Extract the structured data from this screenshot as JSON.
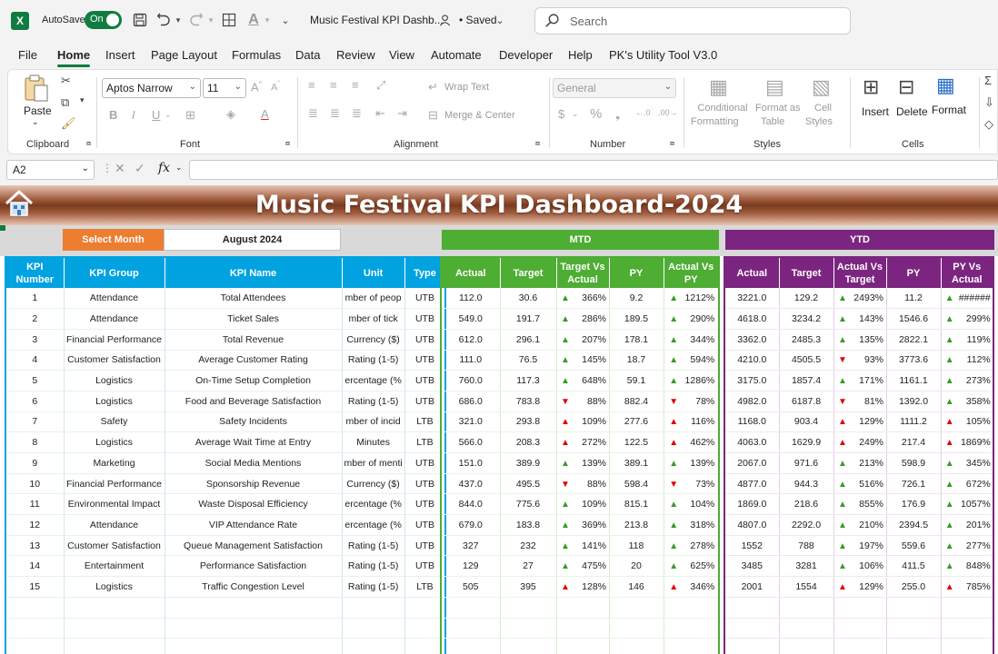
{
  "titlebar": {
    "autosave_label": "AutoSave",
    "toggle_label": "On",
    "doc_title": "Music Festival KPI Dashb...",
    "saved_label": "• Saved",
    "search_placeholder": "Search"
  },
  "menu": [
    "File",
    "Home",
    "Insert",
    "Page Layout",
    "Formulas",
    "Data",
    "Review",
    "View",
    "Automate",
    "Developer",
    "Help",
    "PK's Utility Tool V3.0"
  ],
  "ribbon": {
    "paste": "Paste",
    "clipboard": "Clipboard",
    "font_name": "Aptos Narrow",
    "font_size": "11",
    "font": "Font",
    "wrap_text": "Wrap Text",
    "merge_center": "Merge & Center",
    "alignment": "Alignment",
    "number_format": "General",
    "number": "Number",
    "conditional_formatting": [
      "Conditional",
      "Formatting"
    ],
    "format_as_table": [
      "Format as",
      "Table"
    ],
    "cell_styles": [
      "Cell",
      "Styles"
    ],
    "styles": "Styles",
    "insert": "Insert",
    "delete": "Delete",
    "format": "Format",
    "cells": "Cells"
  },
  "formula_bar": {
    "name_box": "A2",
    "fx": "fx",
    "content": ""
  },
  "sheet": {
    "title": "Music Festival KPI Dashboard-2024",
    "select_month_label": "Select Month",
    "select_month_value": "August 2024",
    "mtd_label": "MTD",
    "ytd_label": "YTD",
    "left_headers": [
      [
        "KPI",
        "Number"
      ],
      [
        "KPI Group"
      ],
      [
        "KPI Name"
      ],
      [
        "Unit"
      ],
      [
        "Type"
      ]
    ],
    "mtd_headers": [
      [
        "Actual"
      ],
      [
        "Target"
      ],
      [
        "Target Vs",
        "Actual"
      ],
      [
        "PY"
      ],
      [
        "Actual Vs",
        "PY"
      ]
    ],
    "ytd_headers": [
      [
        "Actual"
      ],
      [
        "Target"
      ],
      [
        "Actual Vs",
        "Target"
      ],
      [
        "PY"
      ],
      [
        "PY Vs",
        "Actual"
      ]
    ],
    "colors": {
      "mtd": "#4ead33",
      "ytd": "#7b2580",
      "kpi": "#00a3e0",
      "select": "#ed7d31",
      "up": "#3a9a2a",
      "down": "#e00000"
    },
    "rows": [
      {
        "num": "1",
        "group": "Attendance",
        "name": "Total Attendees",
        "unit": "mber of peop",
        "type": "UTB",
        "m_act": "112.0",
        "m_tgt": "30.6",
        "m_tva_dir": "up",
        "m_tva": "366%",
        "m_py": "9.2",
        "m_avp_dir": "up",
        "m_avp": "1212%",
        "y_act": "3221.0",
        "y_tgt": "129.2",
        "y_avt_dir": "up",
        "y_avt": "2493%",
        "y_py": "11.2",
        "y_pva_dir": "up",
        "y_pva": "######"
      },
      {
        "num": "2",
        "group": "Attendance",
        "name": "Ticket Sales",
        "unit": "mber of tick",
        "type": "UTB",
        "m_act": "549.0",
        "m_tgt": "191.7",
        "m_tva_dir": "up",
        "m_tva": "286%",
        "m_py": "189.5",
        "m_avp_dir": "up",
        "m_avp": "290%",
        "y_act": "4618.0",
        "y_tgt": "3234.2",
        "y_avt_dir": "up",
        "y_avt": "143%",
        "y_py": "1546.6",
        "y_pva_dir": "up",
        "y_pva": "299%"
      },
      {
        "num": "3",
        "group": "Financial Performance",
        "name": "Total Revenue",
        "unit": "Currency ($)",
        "type": "UTB",
        "m_act": "612.0",
        "m_tgt": "296.1",
        "m_tva_dir": "up",
        "m_tva": "207%",
        "m_py": "178.1",
        "m_avp_dir": "up",
        "m_avp": "344%",
        "y_act": "3362.0",
        "y_tgt": "2485.3",
        "y_avt_dir": "up",
        "y_avt": "135%",
        "y_py": "2822.1",
        "y_pva_dir": "up",
        "y_pva": "119%"
      },
      {
        "num": "4",
        "group": "Customer Satisfaction",
        "name": "Average Customer Rating",
        "unit": "Rating (1-5)",
        "type": "UTB",
        "m_act": "111.0",
        "m_tgt": "76.5",
        "m_tva_dir": "up",
        "m_tva": "145%",
        "m_py": "18.7",
        "m_avp_dir": "up",
        "m_avp": "594%",
        "y_act": "4210.0",
        "y_tgt": "4505.5",
        "y_avt_dir": "down",
        "y_avt": "93%",
        "y_py": "3773.6",
        "y_pva_dir": "up",
        "y_pva": "112%"
      },
      {
        "num": "5",
        "group": "Logistics",
        "name": "On-Time Setup Completion",
        "unit": "ercentage (%",
        "type": "UTB",
        "m_act": "760.0",
        "m_tgt": "117.3",
        "m_tva_dir": "up",
        "m_tva": "648%",
        "m_py": "59.1",
        "m_avp_dir": "up",
        "m_avp": "1286%",
        "y_act": "3175.0",
        "y_tgt": "1857.4",
        "y_avt_dir": "up",
        "y_avt": "171%",
        "y_py": "1161.1",
        "y_pva_dir": "up",
        "y_pva": "273%"
      },
      {
        "num": "6",
        "group": "Logistics",
        "name": "Food and Beverage Satisfaction",
        "unit": "Rating (1-5)",
        "type": "UTB",
        "m_act": "686.0",
        "m_tgt": "783.8",
        "m_tva_dir": "down",
        "m_tva": "88%",
        "m_py": "882.4",
        "m_avp_dir": "down",
        "m_avp": "78%",
        "y_act": "4982.0",
        "y_tgt": "6187.8",
        "y_avt_dir": "down",
        "y_avt": "81%",
        "y_py": "1392.0",
        "y_pva_dir": "up",
        "y_pva": "358%"
      },
      {
        "num": "7",
        "group": "Safety",
        "name": "Safety Incidents",
        "unit": "mber of incid",
        "type": "LTB",
        "m_act": "321.0",
        "m_tgt": "293.8",
        "m_tva_dir": "down",
        "m_tva": "109%",
        "m_py": "277.6",
        "m_avp_dir": "down",
        "m_avp": "116%",
        "y_act": "1168.0",
        "y_tgt": "903.4",
        "y_avt_dir": "down",
        "y_avt": "129%",
        "y_py": "1111.2",
        "y_pva_dir": "down",
        "y_pva": "105%"
      },
      {
        "num": "8",
        "group": "Logistics",
        "name": "Average Wait Time at Entry",
        "unit": "Minutes",
        "type": "LTB",
        "m_act": "566.0",
        "m_tgt": "208.3",
        "m_tva_dir": "down",
        "m_tva": "272%",
        "m_py": "122.5",
        "m_avp_dir": "down",
        "m_avp": "462%",
        "y_act": "4063.0",
        "y_tgt": "1629.9",
        "y_avt_dir": "down",
        "y_avt": "249%",
        "y_py": "217.4",
        "y_pva_dir": "down",
        "y_pva": "1869%"
      },
      {
        "num": "9",
        "group": "Marketing",
        "name": "Social Media Mentions",
        "unit": "mber of menti",
        "type": "UTB",
        "m_act": "151.0",
        "m_tgt": "389.9",
        "m_tva_dir": "up",
        "m_tva": "139%",
        "m_py": "389.1",
        "m_avp_dir": "up",
        "m_avp": "139%",
        "y_act": "2067.0",
        "y_tgt": "971.6",
        "y_avt_dir": "up",
        "y_avt": "213%",
        "y_py": "598.9",
        "y_pva_dir": "up",
        "y_pva": "345%"
      },
      {
        "num": "10",
        "group": "Financial Performance",
        "name": "Sponsorship Revenue",
        "unit": "Currency ($)",
        "type": "UTB",
        "m_act": "437.0",
        "m_tgt": "495.5",
        "m_tva_dir": "down",
        "m_tva": "88%",
        "m_py": "598.4",
        "m_avp_dir": "down",
        "m_avp": "73%",
        "y_act": "4877.0",
        "y_tgt": "944.3",
        "y_avt_dir": "up",
        "y_avt": "516%",
        "y_py": "726.1",
        "y_pva_dir": "up",
        "y_pva": "672%"
      },
      {
        "num": "11",
        "group": "Environmental Impact",
        "name": "Waste Disposal Efficiency",
        "unit": "ercentage (%",
        "type": "UTB",
        "m_act": "844.0",
        "m_tgt": "775.6",
        "m_tva_dir": "up",
        "m_tva": "109%",
        "m_py": "815.1",
        "m_avp_dir": "up",
        "m_avp": "104%",
        "y_act": "1869.0",
        "y_tgt": "218.6",
        "y_avt_dir": "up",
        "y_avt": "855%",
        "y_py": "176.9",
        "y_pva_dir": "up",
        "y_pva": "1057%"
      },
      {
        "num": "12",
        "group": "Attendance",
        "name": "VIP Attendance Rate",
        "unit": "ercentage (%",
        "type": "UTB",
        "m_act": "679.0",
        "m_tgt": "183.8",
        "m_tva_dir": "up",
        "m_tva": "369%",
        "m_py": "213.8",
        "m_avp_dir": "up",
        "m_avp": "318%",
        "y_act": "4807.0",
        "y_tgt": "2292.0",
        "y_avt_dir": "up",
        "y_avt": "210%",
        "y_py": "2394.5",
        "y_pva_dir": "up",
        "y_pva": "201%"
      },
      {
        "num": "13",
        "group": "Customer Satisfaction",
        "name": "Queue Management Satisfaction",
        "unit": "Rating (1-5)",
        "type": "UTB",
        "m_act": "327",
        "m_tgt": "232",
        "m_tva_dir": "up",
        "m_tva": "141%",
        "m_py": "118",
        "m_avp_dir": "up",
        "m_avp": "278%",
        "y_act": "1552",
        "y_tgt": "788",
        "y_avt_dir": "up",
        "y_avt": "197%",
        "y_py": "559.6",
        "y_pva_dir": "up",
        "y_pva": "277%"
      },
      {
        "num": "14",
        "group": "Entertainment",
        "name": "Performance Satisfaction",
        "unit": "Rating (1-5)",
        "type": "UTB",
        "m_act": "129",
        "m_tgt": "27",
        "m_tva_dir": "up",
        "m_tva": "475%",
        "m_py": "20",
        "m_avp_dir": "up",
        "m_avp": "625%",
        "y_act": "3485",
        "y_tgt": "3281",
        "y_avt_dir": "up",
        "y_avt": "106%",
        "y_py": "411.5",
        "y_pva_dir": "up",
        "y_pva": "848%"
      },
      {
        "num": "15",
        "group": "Logistics",
        "name": "Traffic Congestion Level",
        "unit": "Rating (1-5)",
        "type": "LTB",
        "m_act": "505",
        "m_tgt": "395",
        "m_tva_dir": "down",
        "m_tva": "128%",
        "m_py": "146",
        "m_avp_dir": "down",
        "m_avp": "346%",
        "y_act": "2001",
        "y_tgt": "1554",
        "y_avt_dir": "down",
        "y_avt": "129%",
        "y_py": "255.0",
        "y_pva_dir": "down",
        "y_pva": "785%"
      }
    ]
  }
}
